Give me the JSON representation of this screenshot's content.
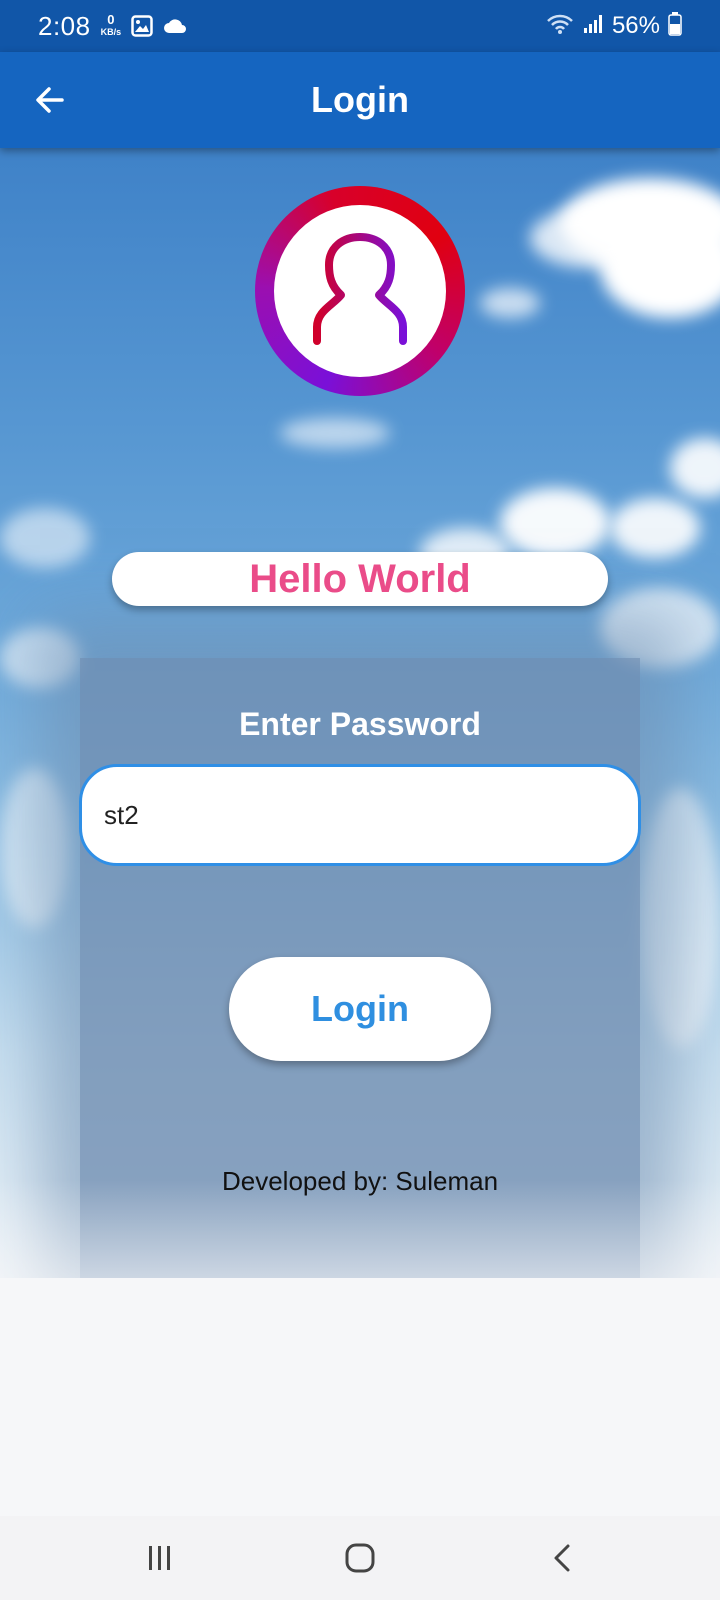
{
  "status_bar": {
    "time": "2:08",
    "net_speed_value": "0",
    "net_speed_unit": "KB/s",
    "battery": "56%",
    "icons": [
      "image-icon",
      "cloud-icon",
      "wifi-icon",
      "signal-icon",
      "battery-icon"
    ]
  },
  "app_bar": {
    "title": "Login",
    "back_icon": "arrow-left-icon"
  },
  "avatar": {
    "icon": "user-icon",
    "ring_colors": [
      "#e00010",
      "#7a10d8"
    ]
  },
  "hello": {
    "text": "Hello World",
    "color": "#ea4c89"
  },
  "password": {
    "label": "Enter Password",
    "value": "st2"
  },
  "login_button": {
    "label": "Login",
    "color": "#2f8fe0"
  },
  "footer": {
    "developer": "Developed by: Suleman"
  },
  "nav_bar": {
    "icons": [
      "recents-icon",
      "home-icon",
      "back-icon"
    ]
  },
  "colors": {
    "status_bar": "#1156a8",
    "app_bar": "#1565c0",
    "field_border": "#2f8fe6"
  }
}
